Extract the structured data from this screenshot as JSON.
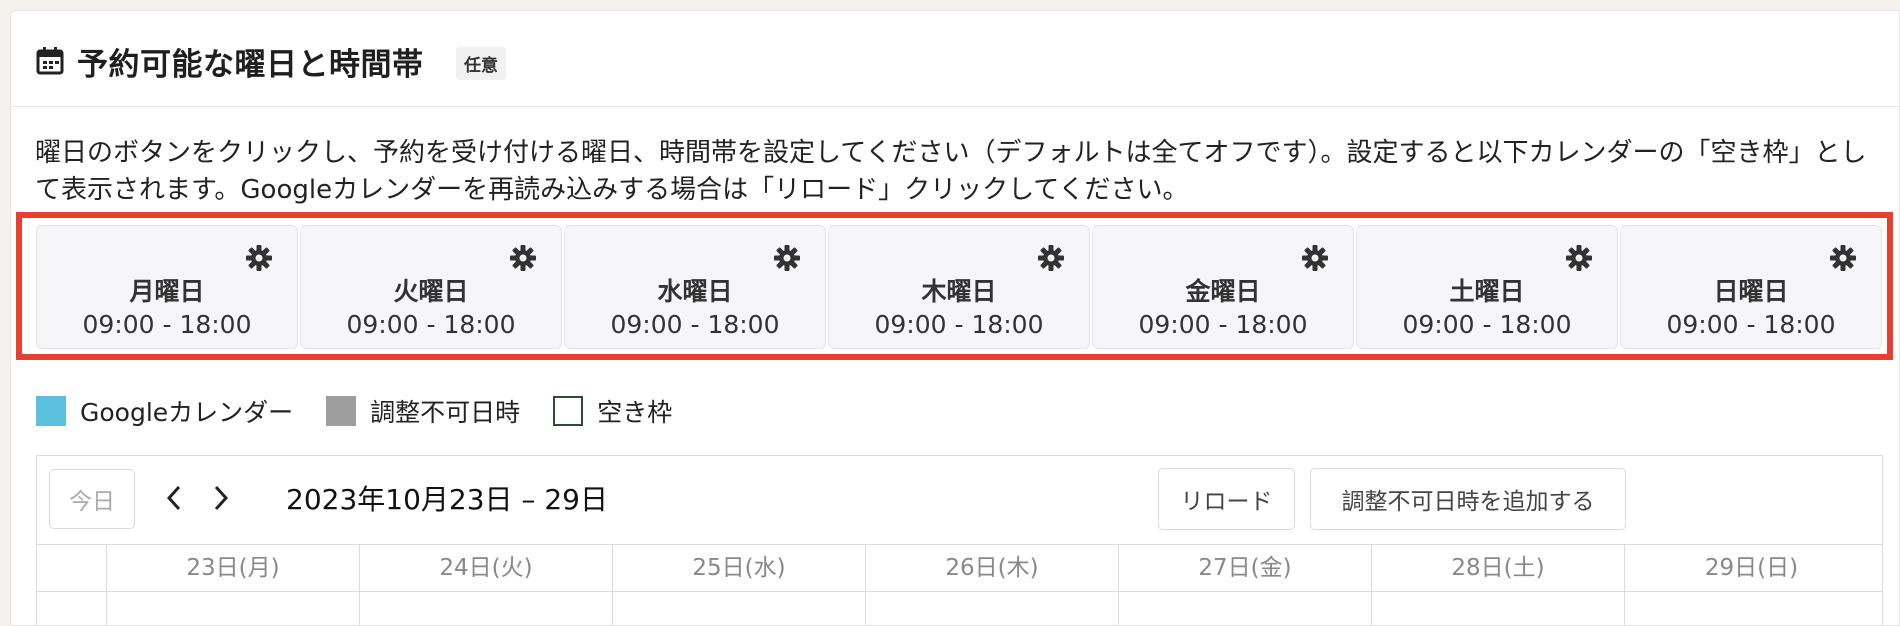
{
  "header": {
    "title": "予約可能な曜日と時間帯",
    "badge": "任意",
    "icon": "calendar-icon"
  },
  "description": "曜日のボタンをクリックし、予約を受け付ける曜日、時間帯を設定してください（デフォルトは全てオフです）。設定すると以下カレンダーの「空き枠」として表示されます。Googleカレンダーを再読み込みする場合は「リロード」クリックしてください。",
  "highlight_color": "#e8402f",
  "days": [
    {
      "name": "月曜日",
      "time": "09:00 - 18:00"
    },
    {
      "name": "火曜日",
      "time": "09:00 - 18:00"
    },
    {
      "name": "水曜日",
      "time": "09:00 - 18:00"
    },
    {
      "name": "木曜日",
      "time": "09:00 - 18:00"
    },
    {
      "name": "金曜日",
      "time": "09:00 - 18:00"
    },
    {
      "name": "土曜日",
      "time": "09:00 - 18:00"
    },
    {
      "name": "日曜日",
      "time": "09:00 - 18:00"
    }
  ],
  "legend": [
    {
      "label": "Googleカレンダー",
      "color": "#5bc0de"
    },
    {
      "label": "調整不可日時",
      "color": "#9e9e9e"
    },
    {
      "label": "空き枠",
      "color": "#2e4d2e"
    }
  ],
  "calendar": {
    "today_label": "今日",
    "range_title": "2023年10月23日 – 29日",
    "reload_label": "リロード",
    "add_label": "調整不可日時を追加する",
    "columns": [
      "23日(月)",
      "24日(火)",
      "25日(水)",
      "26日(木)",
      "27日(金)",
      "28日(土)",
      "29日(日)"
    ]
  }
}
